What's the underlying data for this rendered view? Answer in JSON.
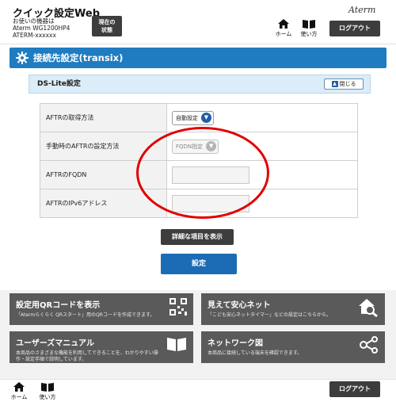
{
  "header": {
    "app_title": "クイック設定Web",
    "device_label": "お使いの機器は",
    "device_model": "Aterm WG1200HP4",
    "device_id": "ATERM-xxxxxx",
    "status_button_line1": "現在の",
    "status_button_line2": "状態",
    "brand": "Aterm",
    "home_label": "ホーム",
    "usage_label": "使い方",
    "logout_label": "ログアウト"
  },
  "section": {
    "title": "接続先設定(transix)"
  },
  "panel": {
    "title": "DS-Lite設定",
    "collapse_label": "閉じる",
    "rows": [
      {
        "label": "AFTRの取得方法",
        "value": "自動設定"
      },
      {
        "label": "手動時のAFTRの設定方法",
        "value": "FQDN指定"
      },
      {
        "label": "AFTRのFQDN",
        "value": ""
      },
      {
        "label": "AFTRのIPv6アドレス",
        "value": ""
      }
    ]
  },
  "buttons": {
    "advanced_label": "詳細な項目を表示",
    "save_label": "設定"
  },
  "tiles": [
    {
      "title": "設定用QRコードを表示",
      "desc": "「Atermらくらく QRスタート」用のQRコードを作成できます。",
      "icon": "qr-code-icon"
    },
    {
      "title": "見えて安心ネット",
      "desc": "「こども安心ネットタイマー」などの設定はこちらから。",
      "icon": "home-search-icon"
    },
    {
      "title": "ユーザーズマニュアル",
      "desc": "本商品のさまざまな機能を利用してできることを、わかりやすい操作・設定手順で説明しています。",
      "icon": "book-icon"
    },
    {
      "title": "ネットワーク図",
      "desc": "本商品に接続している端末を確認できます。",
      "icon": "network-icon"
    }
  ],
  "footer": {
    "home_label": "ホーム",
    "usage_label": "使い方",
    "logout_label": "ログアウト"
  },
  "colors": {
    "primary_blue": "#1f7cc0",
    "dark_button": "#3d3d3d",
    "tile_gray": "#5a5a5a",
    "annotation_red": "#e10000"
  }
}
